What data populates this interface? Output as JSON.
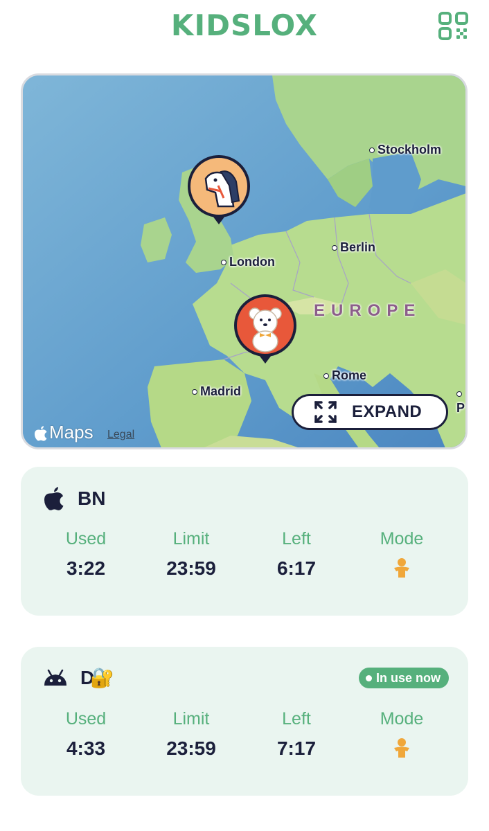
{
  "header": {
    "logo_text": "KIDSLOX",
    "qr_icon": "qr-code-icon"
  },
  "map": {
    "cities": [
      {
        "name": "Stockholm"
      },
      {
        "name": "Berlin"
      },
      {
        "name": "London"
      },
      {
        "name": "Rome"
      },
      {
        "name": "Madrid"
      },
      {
        "name": "P"
      }
    ],
    "region_label": "EUROPE",
    "expand_label": "EXPAND",
    "brand_label": "Maps",
    "legal_label": "Legal",
    "pins": [
      {
        "avatar": "horse-avatar",
        "color": "#f5b97a"
      },
      {
        "avatar": "teddy-bear-avatar",
        "color": "#e8583a"
      }
    ]
  },
  "devices": [
    {
      "platform_icon": "apple-icon",
      "name": "BN",
      "in_use": false,
      "stats": {
        "used_label": "Used",
        "used": "3:22",
        "limit_label": "Limit",
        "limit": "23:59",
        "left_label": "Left",
        "left": "6:17",
        "mode_label": "Mode"
      },
      "mode_icon": "child-mode-icon"
    },
    {
      "platform_icon": "android-icon",
      "name": "D",
      "name_suffix": "🔐",
      "in_use": true,
      "badge_label": "In use now",
      "stats": {
        "used_label": "Used",
        "used": "4:33",
        "limit_label": "Limit",
        "limit": "23:59",
        "left_label": "Left",
        "left": "7:17",
        "mode_label": "Mode"
      },
      "mode_icon": "child-mode-icon"
    }
  ],
  "colors": {
    "accent": "#56b07c",
    "text": "#1b1f3b",
    "mode": "#f0a73a",
    "card_bg": "#eaf5f0"
  }
}
